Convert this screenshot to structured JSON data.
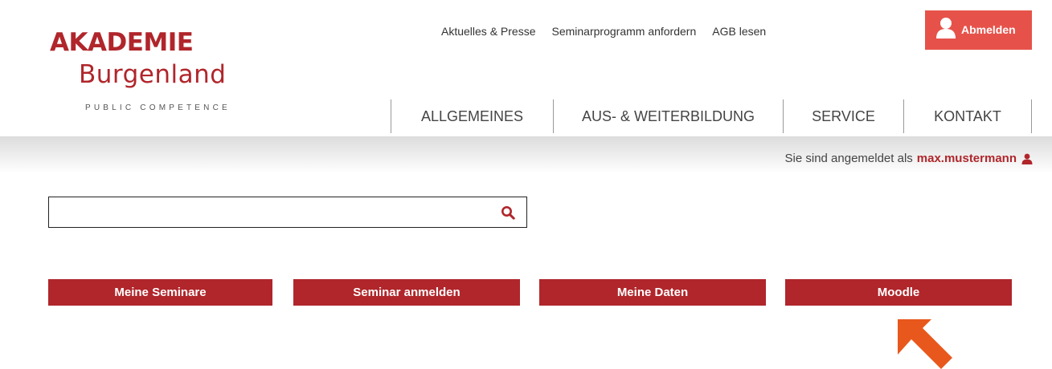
{
  "logo": {
    "line1": "AKADEMIE",
    "line2": "Burgenland",
    "line3": "PUBLIC COMPETENCE"
  },
  "top_links": [
    "Aktuelles & Presse",
    "Seminarprogramm anfordern",
    "AGB lesen"
  ],
  "logout": {
    "label": "Abmelden",
    "icon": "user-icon"
  },
  "main_nav": [
    "ALLGEMEINES",
    "AUS- & WEITERBILDUNG",
    "SERVICE",
    "KONTAKT"
  ],
  "login_status": {
    "prefix": "Sie sind angemeldet als",
    "username": "max.mustermann",
    "icon": "user-icon"
  },
  "search": {
    "value": "",
    "placeholder": "",
    "icon": "search-icon"
  },
  "actions": [
    "Meine Seminare",
    "Seminar anmelden",
    "Meine Daten",
    "Moodle"
  ],
  "annotation": {
    "icon": "pointer-arrow-icon",
    "color": "#e8581c"
  },
  "colors": {
    "brand": "#b0262b",
    "logout": "#e6524a"
  }
}
